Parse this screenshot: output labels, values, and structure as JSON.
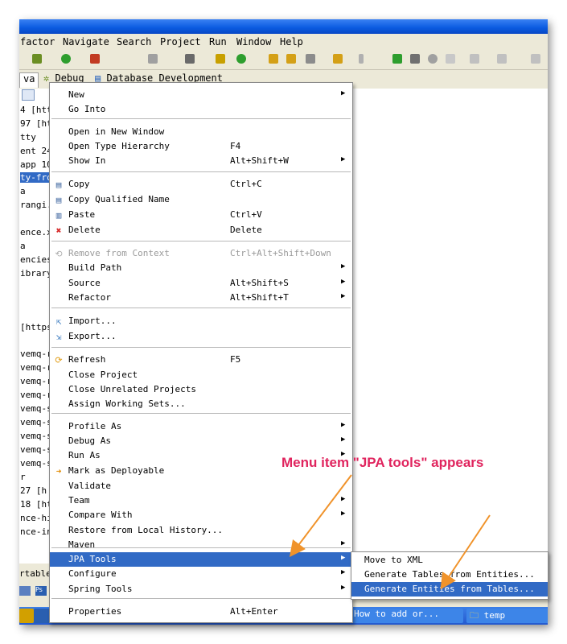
{
  "menubar": [
    "factor",
    "Navigate",
    "Search",
    "Project",
    "Run",
    "Window",
    "Help"
  ],
  "tabs": {
    "java": "va",
    "debug": "Debug",
    "database": "Database Development"
  },
  "left_pane_lines": [
    "4 [htt",
    "97 [ht",
    "tty",
    "ent 24",
    "app 10",
    "ty-fro",
    "a",
    "rangi.",
    "",
    "ence.x",
    "a",
    "encies",
    "ibrary",
    "",
    "",
    "[https",
    "",
    "vemq-r",
    "vemq-r",
    "vemq-r",
    "vemq-r",
    "vemq-s",
    "vemq-s",
    "vemq-s",
    "vemq-s",
    "vemq-s",
    "r",
    "27 [h",
    "18 [ht",
    "nce-hi",
    "nce-in"
  ],
  "bottom_strip_text": "rtable",
  "context_menu": {
    "items": [
      {
        "label": "New",
        "shortcut": "",
        "submenu": true
      },
      {
        "label": "Go Into",
        "shortcut": ""
      },
      {
        "label": "Open in New Window",
        "shortcut": ""
      },
      {
        "label": "Open Type Hierarchy",
        "shortcut": "F4"
      },
      {
        "label": "Show In",
        "shortcut": "Alt+Shift+W",
        "submenu": true
      },
      {
        "label": "Copy",
        "shortcut": "Ctrl+C",
        "icon": "copy-icon"
      },
      {
        "label": "Copy Qualified Name",
        "shortcut": "",
        "icon": "copy-qualified-icon"
      },
      {
        "label": "Paste",
        "shortcut": "Ctrl+V",
        "icon": "paste-icon"
      },
      {
        "label": "Delete",
        "shortcut": "Delete",
        "icon": "delete-icon"
      },
      {
        "label": "Remove from Context",
        "shortcut": "Ctrl+Alt+Shift+Down",
        "disabled": true,
        "icon": "remove-context-icon"
      },
      {
        "label": "Build Path",
        "shortcut": "",
        "submenu": true
      },
      {
        "label": "Source",
        "shortcut": "Alt+Shift+S",
        "submenu": true
      },
      {
        "label": "Refactor",
        "shortcut": "Alt+Shift+T",
        "submenu": true
      },
      {
        "label": "Import...",
        "shortcut": "",
        "icon": "import-icon"
      },
      {
        "label": "Export...",
        "shortcut": "",
        "icon": "export-icon"
      },
      {
        "label": "Refresh",
        "shortcut": "F5",
        "icon": "refresh-icon"
      },
      {
        "label": "Close Project",
        "shortcut": ""
      },
      {
        "label": "Close Unrelated Projects",
        "shortcut": ""
      },
      {
        "label": "Assign Working Sets...",
        "shortcut": ""
      },
      {
        "label": "Profile As",
        "shortcut": "",
        "submenu": true
      },
      {
        "label": "Debug As",
        "shortcut": "",
        "submenu": true
      },
      {
        "label": "Run As",
        "shortcut": "",
        "submenu": true
      },
      {
        "label": "Mark as Deployable",
        "shortcut": "",
        "icon": "deployable-icon"
      },
      {
        "label": "Validate",
        "shortcut": ""
      },
      {
        "label": "Team",
        "shortcut": "",
        "submenu": true
      },
      {
        "label": "Compare With",
        "shortcut": "",
        "submenu": true
      },
      {
        "label": "Restore from Local History...",
        "shortcut": ""
      },
      {
        "label": "Maven",
        "shortcut": "",
        "submenu": true
      },
      {
        "label": "JPA Tools",
        "shortcut": "",
        "submenu": true,
        "highlighted": true
      },
      {
        "label": "Configure",
        "shortcut": "",
        "submenu": true
      },
      {
        "label": "Spring Tools",
        "shortcut": "",
        "submenu": true
      },
      {
        "label": "Properties",
        "shortcut": "Alt+Enter"
      }
    ]
  },
  "jpa_submenu": [
    {
      "label": "Move to XML"
    },
    {
      "label": "Generate Tables from Entities..."
    },
    {
      "label": "Generate Entities from Tables...",
      "highlighted": true
    }
  ],
  "annotation": "Menu item \"JPA tools\" appears",
  "taskbar": {
    "task1": "How to add or...",
    "task2": "temp"
  },
  "colors": {
    "highlight": "#316ac5",
    "annotation": "#e0245e",
    "arrow": "#f0932b"
  }
}
